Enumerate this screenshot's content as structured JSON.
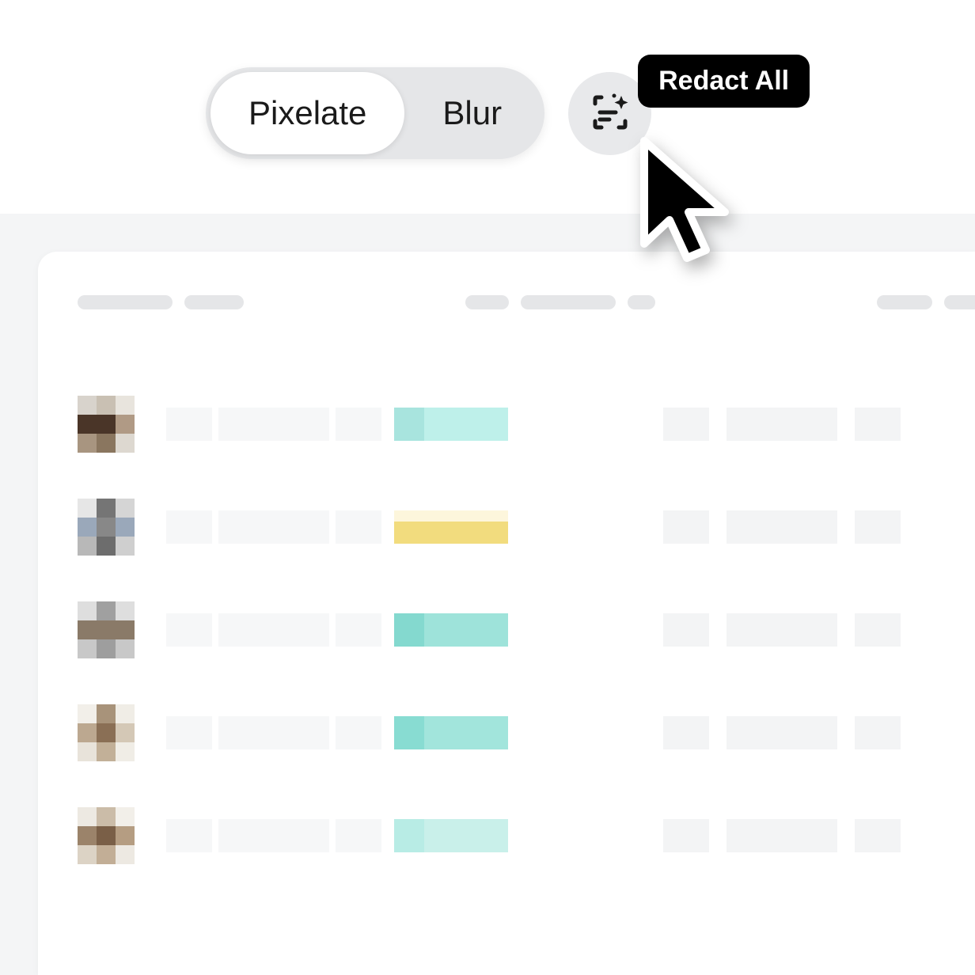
{
  "toolbar": {
    "segments": {
      "pixelate": "Pixelate",
      "blur": "Blur"
    },
    "redact_button": {
      "tooltip": "Redact All"
    }
  },
  "table": {
    "rows": [
      {
        "avatar_colors": [
          "#d8d3cc",
          "#c9c0b3",
          "#e8e4dd",
          "#4a3528",
          "#4a3528",
          "#b09a85",
          "#a89580",
          "#8a765f",
          "#ddd8d0"
        ],
        "status_colors": [
          "#a8e4de",
          "#bef0ea"
        ]
      },
      {
        "avatar_colors": [
          "#e6e6e6",
          "#757575",
          "#d5d5d5",
          "#9aa8ba",
          "#888888",
          "#9aa8ba",
          "#b8b8b8",
          "#6d6d6d",
          "#cfcfcf"
        ],
        "status_colors": [
          "#fdf6dc",
          "#f2dc7e"
        ]
      },
      {
        "avatar_colors": [
          "#dedede",
          "#a0a0a0",
          "#dedede",
          "#8a7a68",
          "#8a7a68",
          "#8a7a68",
          "#c8c8c8",
          "#9e9e9e",
          "#c8c8c8"
        ],
        "status_colors": [
          "#84d9cf",
          "#9ee3da"
        ]
      },
      {
        "avatar_colors": [
          "#f2efe9",
          "#a8937a",
          "#f0ede6",
          "#bca890",
          "#8a6f55",
          "#d4c8b6",
          "#e8e3da",
          "#c2b098",
          "#f0ede6"
        ],
        "status_colors": [
          "#88dcd2",
          "#a2e5dc"
        ]
      },
      {
        "avatar_colors": [
          "#ede9e2",
          "#cbbca8",
          "#f2efe9",
          "#9b836a",
          "#7a5f47",
          "#b59d82",
          "#dcd3c5",
          "#c2ae96",
          "#ede9e2"
        ],
        "status_colors": [
          "#b8ece5",
          "#c9f0ea"
        ]
      }
    ]
  }
}
